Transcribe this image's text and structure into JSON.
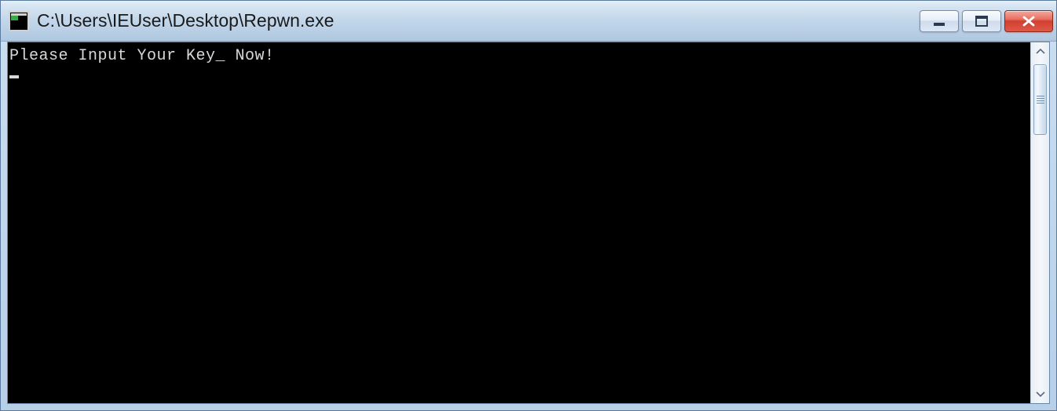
{
  "window": {
    "title": "C:\\Users\\IEUser\\Desktop\\Repwn.exe"
  },
  "console": {
    "lines": [
      "Please Input Your Key_ Now!"
    ],
    "cursor_visible": true
  },
  "icons": {
    "app": "console-app-icon",
    "minimize": "minimize-icon",
    "maximize": "maximize-icon",
    "close": "close-icon",
    "scroll_up": "chevron-up-icon",
    "scroll_down": "chevron-down-icon"
  }
}
